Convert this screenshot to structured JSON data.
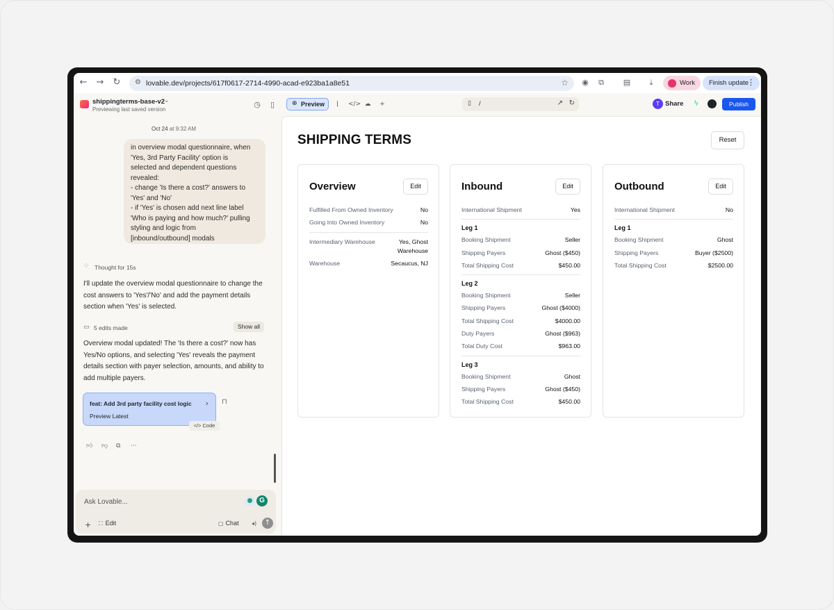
{
  "browser": {
    "url": "lovable.dev/projects/617f0617-2714-4990-acad-e923ba1a8e51",
    "profile_label": "Work",
    "finish_update_label": "Finish update"
  },
  "project": {
    "name": "shippingterms-base-v2",
    "status": "Previewing last saved version"
  },
  "chat": {
    "date": "Oct 24",
    "time": "at 9:32 AM",
    "user_message_lines": [
      "in overview modal questionnaire, when",
      "'Yes, 3rd Party Facility' option is",
      "selected and dependent questions",
      "revealed:",
      "- change 'Is there a cost?' answers to",
      "'Yes' and 'No'",
      "- if 'Yes' is chosen add next line label",
      "'Who is paying and how much?' pulling",
      "styling and logic from",
      "[inbound/outbound] modals"
    ],
    "thought": "Thought for 15s",
    "reply1": "I'll update the overview modal questionnaire to change the cost answers to 'Yes'/'No' and add the payment details section when 'Yes' is selected.",
    "edits_label": "5 edits made",
    "show_all_label": "Show all",
    "reply2": "Overview modal updated! The 'Is there a cost?' now has Yes/No options, and selecting 'Yes' reveals the payment details section with payer selection, amounts, and ability to add multiple payers.",
    "commit_title": "feat: Add 3rd party facility cost logic",
    "commit_sub": "Preview Latest",
    "code_label": "Code",
    "input_placeholder": "Ask Lovable...",
    "grammarly_letter": "G",
    "edit_label": "Edit",
    "chat_label": "Chat"
  },
  "toolbar": {
    "preview_label": "Preview",
    "route": "/",
    "share_avatar": "T",
    "share_label": "Share",
    "publish_label": "Publish"
  },
  "page": {
    "title": "SHIPPING TERMS",
    "reset_label": "Reset",
    "edit_label": "Edit",
    "overview": {
      "title": "Overview",
      "rows": [
        {
          "k": "Fulfilled From Owned Inventory",
          "v": "No"
        },
        {
          "k": "Going Into Owned Inventory",
          "v": "No"
        }
      ],
      "rows2": [
        {
          "k": "Intermediary Warehouse",
          "v": "Yes, Ghost Warehouse"
        },
        {
          "k": "Warehouse",
          "v": "Secaucus, NJ"
        }
      ]
    },
    "inbound": {
      "title": "Inbound",
      "international": {
        "k": "International Shipment",
        "v": "Yes"
      },
      "legs": [
        {
          "label": "Leg 1",
          "rows": [
            {
              "k": "Booking Shipment",
              "v": "Seller"
            },
            {
              "k": "Shipping Payers",
              "v": "Ghost ($450)"
            },
            {
              "k": "Total Shipping Cost",
              "v": "$450.00"
            }
          ]
        },
        {
          "label": "Leg 2",
          "rows": [
            {
              "k": "Booking Shipment",
              "v": "Seller"
            },
            {
              "k": "Shipping Payers",
              "v": "Ghost ($4000)"
            },
            {
              "k": "Total Shipping Cost",
              "v": "$4000.00"
            },
            {
              "k": "Duty Payers",
              "v": "Ghost ($963)"
            },
            {
              "k": "Total Duty Cost",
              "v": "$963.00"
            }
          ]
        },
        {
          "label": "Leg 3",
          "rows": [
            {
              "k": "Booking Shipment",
              "v": "Ghost"
            },
            {
              "k": "Shipping Payers",
              "v": "Ghost ($450)"
            },
            {
              "k": "Total Shipping Cost",
              "v": "$450.00"
            }
          ]
        }
      ]
    },
    "outbound": {
      "title": "Outbound",
      "international": {
        "k": "International Shipment",
        "v": "No"
      },
      "legs": [
        {
          "label": "Leg 1",
          "rows": [
            {
              "k": "Booking Shipment",
              "v": "Ghost"
            },
            {
              "k": "Shipping Payers",
              "v": "Buyer ($2500)"
            },
            {
              "k": "Total Shipping Cost",
              "v": "$2500.00"
            }
          ]
        }
      ]
    }
  }
}
